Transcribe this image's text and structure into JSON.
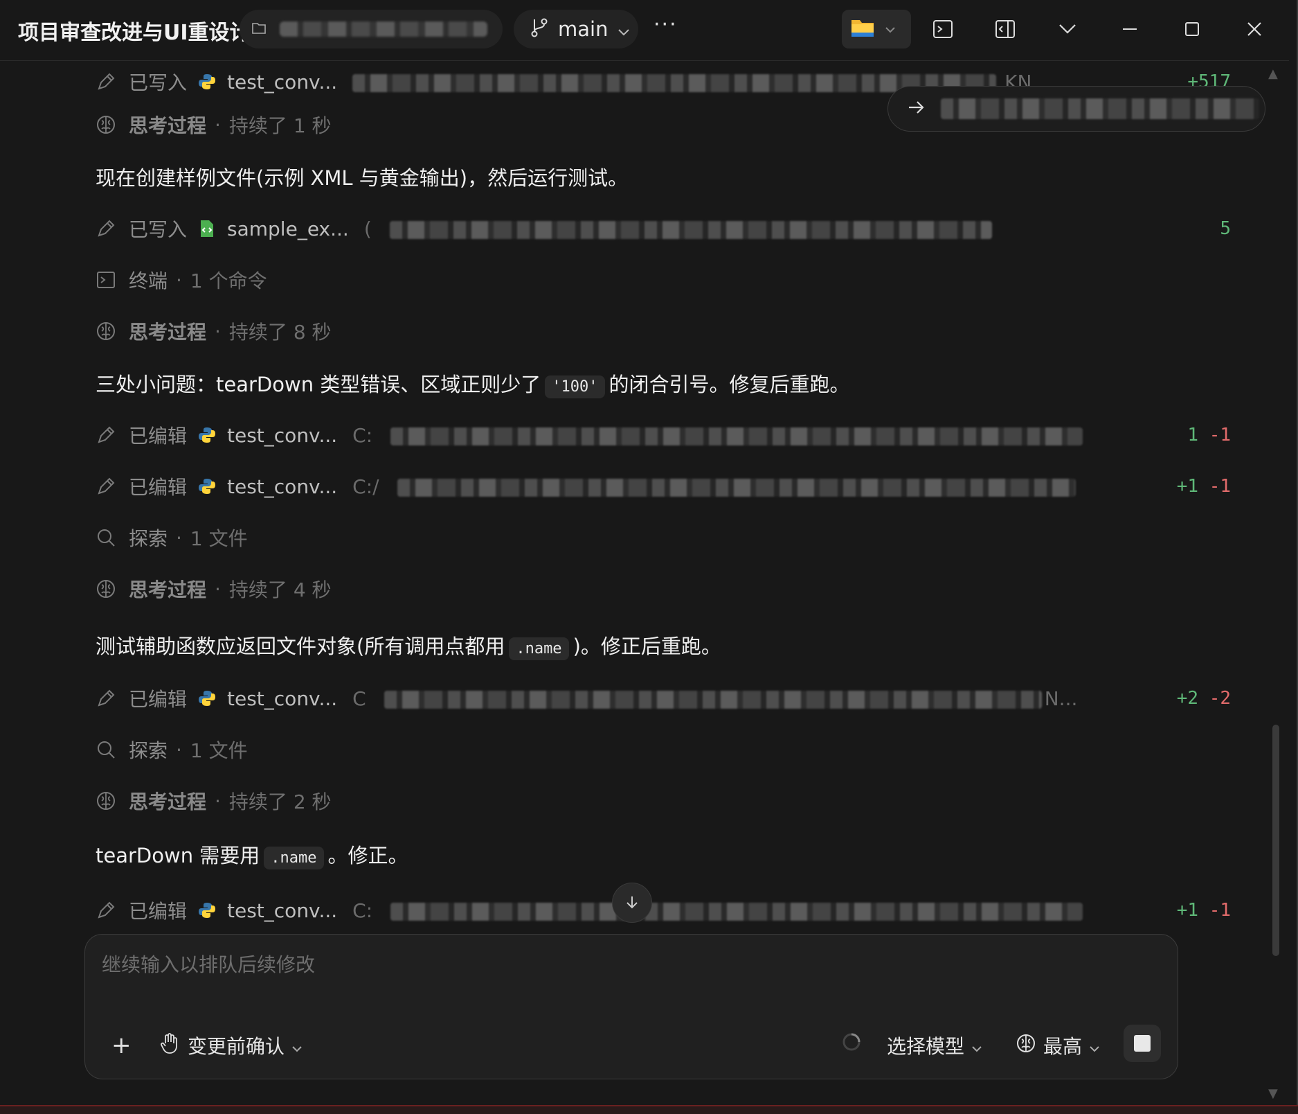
{
  "app": {
    "title": "项目审查改进与UI重设计",
    "branch": "main",
    "more": "···"
  },
  "titlebar": {
    "icons": [
      "folder-icon",
      "terminal-icon",
      "sidebar-toggle-icon",
      "chevron-down-icon",
      "minimize-icon",
      "maximize-icon",
      "close-icon"
    ]
  },
  "jump": {
    "arrow": "→"
  },
  "rows": [
    {
      "verb": "已写入",
      "file": "test_conv...",
      "path_tail": "KN...",
      "add": "+517",
      "del": ""
    },
    {
      "kind": "think",
      "label": "思考过程",
      "detail": "持续了 1 秒"
    },
    {
      "kind": "msg",
      "text": "现在创建样例文件(示例 XML 与黄金输出)，然后运行测试。"
    },
    {
      "verb": "已写入",
      "file": "sample_ex...",
      "path_head": "(",
      "add": "5",
      "del": ""
    },
    {
      "kind": "terminal",
      "label": "终端",
      "detail": "1 个命令"
    },
    {
      "kind": "think",
      "label": "思考过程",
      "detail": "持续了 8 秒"
    },
    {
      "kind": "msg",
      "text_a": "三处小问题：tearDown 类型错误、区域正则少了",
      "code": "'100'",
      "text_b": "的闭合引号。修复后重跑。"
    },
    {
      "verb": "已编辑",
      "file": "test_conv...",
      "path_head": "C:",
      "add": "1",
      "del": "-1"
    },
    {
      "verb": "已编辑",
      "file": "test_conv...",
      "path_head": "C:/",
      "add": "+1",
      "del": "-1"
    },
    {
      "kind": "explore",
      "label": "探索",
      "detail": "1 文件"
    },
    {
      "kind": "think",
      "label": "思考过程",
      "detail": "持续了 4 秒"
    },
    {
      "kind": "msg",
      "text_a": "测试辅助函数应返回文件对象(所有调用点都用",
      "code": ".name",
      "text_b": ")。修正后重跑。"
    },
    {
      "verb": "已编辑",
      "file": "test_conv...",
      "path_head": "C",
      "path_tail": "N...",
      "add": "+2",
      "del": "-2"
    },
    {
      "kind": "explore",
      "label": "探索",
      "detail": "1 文件"
    },
    {
      "kind": "think",
      "label": "思考过程",
      "detail": "持续了 2 秒"
    },
    {
      "kind": "msg",
      "text_a": "tearDown 需要用",
      "code": ".name",
      "text_b": "。修正。"
    },
    {
      "verb": "已编辑",
      "file": "test_conv...",
      "path_head": "C:",
      "add": "+1",
      "del": "-1"
    }
  ],
  "composer": {
    "placeholder": "继续输入以排队后续修改",
    "plus": "+",
    "approval": "变更前确认",
    "model": "选择模型",
    "effort": "最高"
  },
  "colors": {
    "add": "#5fb878",
    "del": "#e26b6b",
    "python_blue": "#3776ab",
    "python_yellow": "#ffd43b"
  }
}
